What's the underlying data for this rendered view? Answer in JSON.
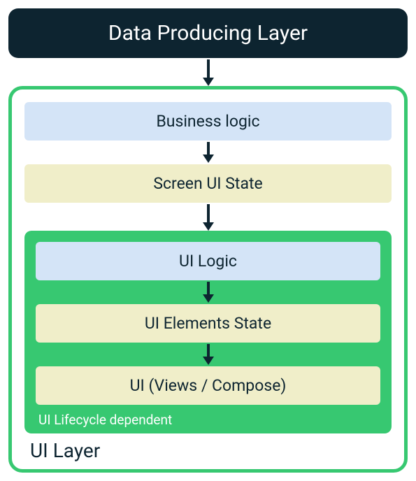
{
  "diagram": {
    "top_layer": "Data Producing Layer",
    "ui_layer": {
      "label": "UI Layer",
      "business_logic": "Business logic",
      "screen_ui_state": "Screen UI State",
      "lifecycle": {
        "label": "UI Lifecycle dependent",
        "ui_logic": "UI Logic",
        "ui_elements_state": "UI Elements State",
        "ui_views": "UI (Views / Compose)"
      }
    }
  },
  "colors": {
    "dark": "#0d2430",
    "green": "#37c871",
    "blue": "#d4e4f7",
    "cream": "#f0eec9"
  }
}
